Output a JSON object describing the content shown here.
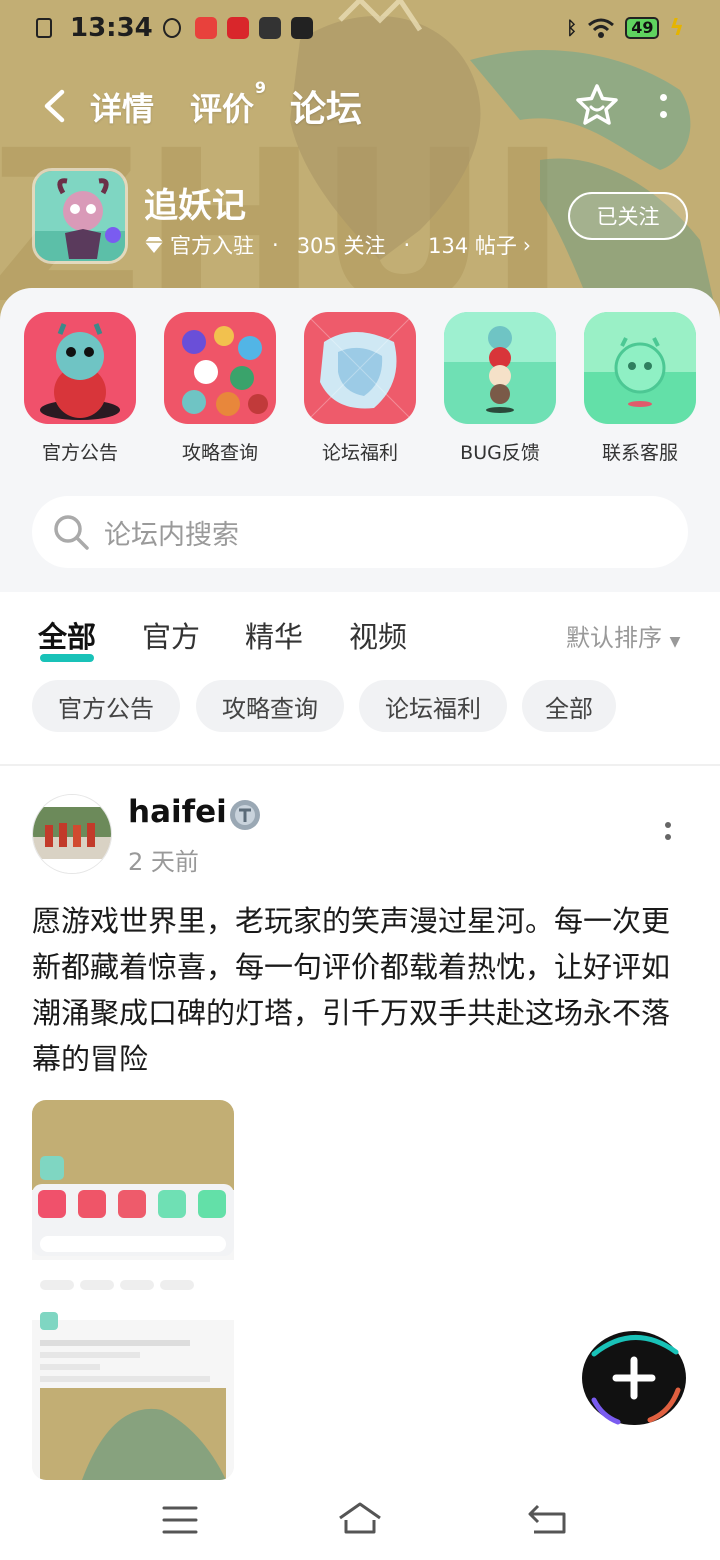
{
  "status_bar": {
    "time": "13:34",
    "battery": "49"
  },
  "top_nav": {
    "tabs": [
      {
        "label": "详情"
      },
      {
        "label": "评价",
        "badge": "9"
      },
      {
        "label": "论坛",
        "active": true
      }
    ]
  },
  "game": {
    "name": "追妖记",
    "official": "官方入驻",
    "follows": "305 关注",
    "posts": "134 帖子",
    "follow_button": "已关注"
  },
  "quick_links": [
    {
      "label": "官方公告"
    },
    {
      "label": "攻略查询"
    },
    {
      "label": "论坛福利"
    },
    {
      "label": "BUG反馈"
    },
    {
      "label": "联系客服"
    }
  ],
  "search": {
    "placeholder": "论坛内搜索"
  },
  "filter_tabs": [
    {
      "label": "全部",
      "active": true
    },
    {
      "label": "官方"
    },
    {
      "label": "精华"
    },
    {
      "label": "视频"
    }
  ],
  "sort_label": "默认排序",
  "chips": [
    {
      "label": "官方公告"
    },
    {
      "label": "攻略查询"
    },
    {
      "label": "论坛福利"
    },
    {
      "label": "全部"
    }
  ],
  "post": {
    "author": "haifei",
    "time": "2 天前",
    "content": "愿游戏世界里，老玩家的笑声漫过星河。每一次更新都藏着惊喜，每一句评价都载着热忱，让好评如潮涌聚成口碑的灯塔，引千万双手共赴这场永不落幕的冒险"
  },
  "colors": {
    "accent": "#19c2b8",
    "banner": "#c3af75"
  }
}
